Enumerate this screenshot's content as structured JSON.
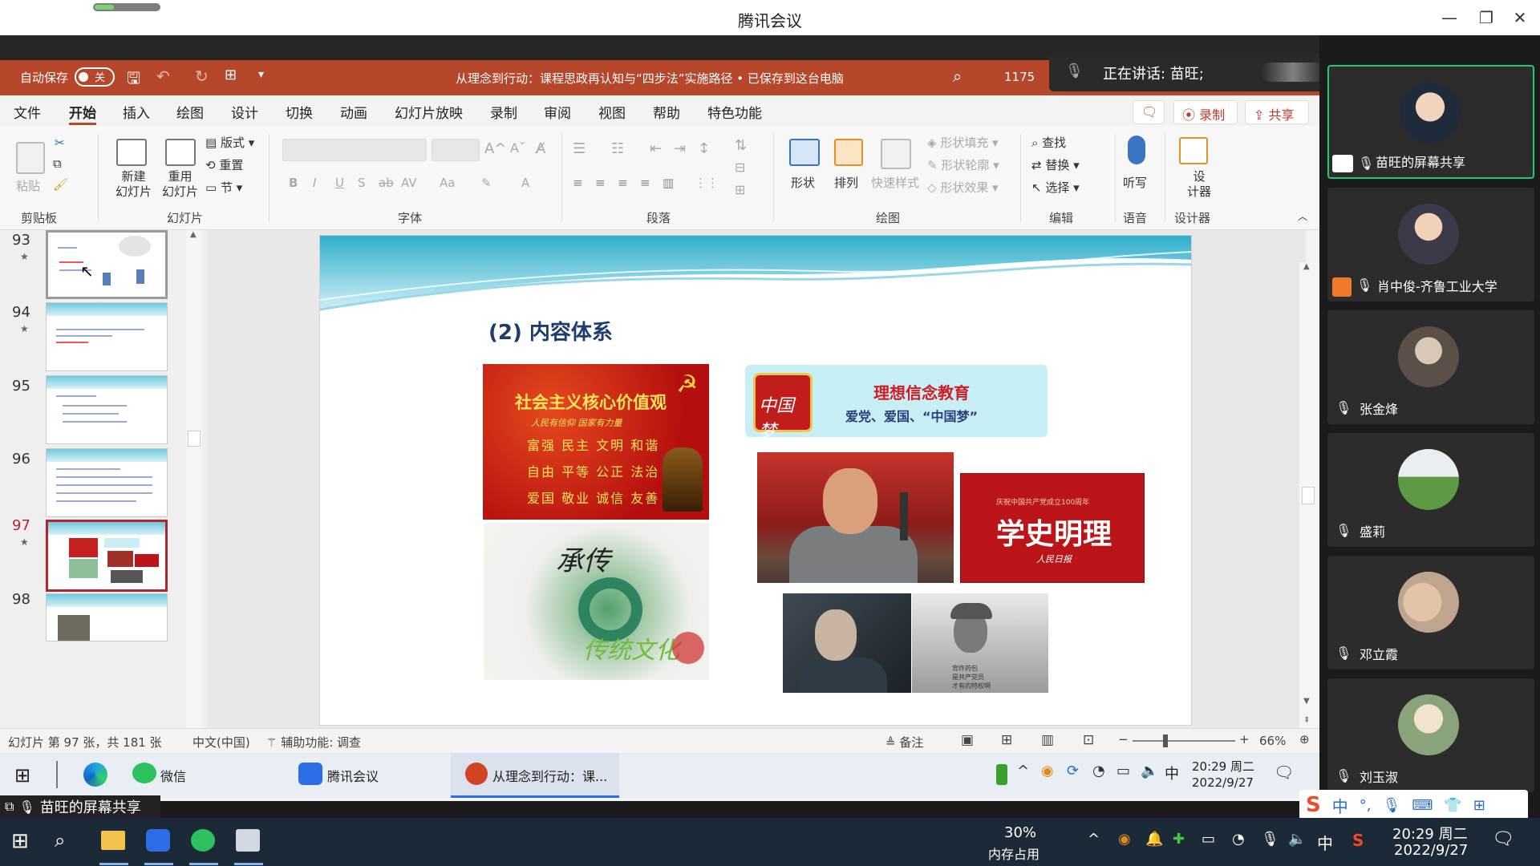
{
  "meeting": {
    "title": "腾讯会议",
    "speaking_text": "正在讲话: 苗旺;",
    "shared_label": "苗旺的屏幕共享"
  },
  "ppt": {
    "autosave_label": "自动保存",
    "autosave_state": "关",
    "document_title": "从理念到行动：课程思政再认知与“四步法”实施路径 • 已保存到这台电脑",
    "top_counter": "1175",
    "tabs": [
      "文件",
      "开始",
      "插入",
      "绘图",
      "设计",
      "切换",
      "动画",
      "幻灯片放映",
      "录制",
      "审阅",
      "视图",
      "帮助",
      "特色功能"
    ],
    "active_tab": "开始",
    "record_btn": "录制",
    "share_btn": "共享",
    "ribbon": {
      "paste": "粘贴",
      "new_slide": "新建\n幻灯片",
      "reuse_slide": "重用\n幻灯片",
      "layout": "版式",
      "reset": "重置",
      "section": "节",
      "shape": "形状",
      "arrange": "排列",
      "quick_style": "快速样式",
      "shape_fill": "形状填充",
      "shape_outline": "形状轮廓",
      "shape_effect": "形状效果",
      "find": "查找",
      "replace": "替换",
      "select": "选择",
      "dictate": "听写",
      "designer": "设\n计器",
      "groups": {
        "clipboard": "剪贴板",
        "slides": "幻灯片",
        "font": "字体",
        "paragraph": "段落",
        "drawing": "绘图",
        "editing": "编辑",
        "voice": "语音",
        "designer": "设计器"
      }
    },
    "thumbnails": [
      {
        "num": "93"
      },
      {
        "num": "94"
      },
      {
        "num": "95"
      },
      {
        "num": "96"
      },
      {
        "num": "97"
      },
      {
        "num": "98"
      }
    ],
    "slide": {
      "heading": "(2)  内容体系",
      "core_values_title": "社会主义核心价值观",
      "core_values_sub": "人民有信仰 国家有力量",
      "core_values_rows": [
        "富强  民主  文明  和谐",
        "自由  平等  公正  法治",
        "爱国  敬业  诚信  友善"
      ],
      "culture_text_1": "承传",
      "culture_text_2": "传统文化",
      "dream_logo": "中国梦",
      "ideal_title": "理想信念教育",
      "ideal_sub": "爱党、爱国、“中国梦”",
      "history_small": "庆祝中国共产党成立100周年",
      "history_big": "学史明理",
      "history_sig": "人民日报",
      "soldier_caption": "背炸药包\n是共产党员\n才有的特权啊"
    },
    "status": {
      "slide_info": "幻灯片 第 97 张，共 181 张",
      "language": "中文(中国)",
      "accessibility": "辅助功能: 调查",
      "notes": "备注",
      "zoom": "66%"
    }
  },
  "inner_taskbar": {
    "wechat": "微信",
    "meeting": "腾讯会议",
    "ppt_item": "从理念到行动：课...",
    "time": "20:29 周二",
    "date": "2022/9/27",
    "ime": "中"
  },
  "participants": [
    {
      "name": "苗旺的屏幕共享"
    },
    {
      "name": "肖中俊-齐鲁工业大学"
    },
    {
      "name": "张金烽"
    },
    {
      "name": "盛莉"
    },
    {
      "name": "邓立霞"
    },
    {
      "name": "刘玉淑"
    }
  ],
  "os_taskbar": {
    "mem_pct": "30%",
    "mem_label": "内存占用",
    "ime": "中",
    "time": "20:29 周二",
    "date": "2022/9/27"
  },
  "colors": {
    "ppt_accent": "#b7472a",
    "active_speaker": "#1fcb6c",
    "selected_thumb": "#b3242c"
  }
}
